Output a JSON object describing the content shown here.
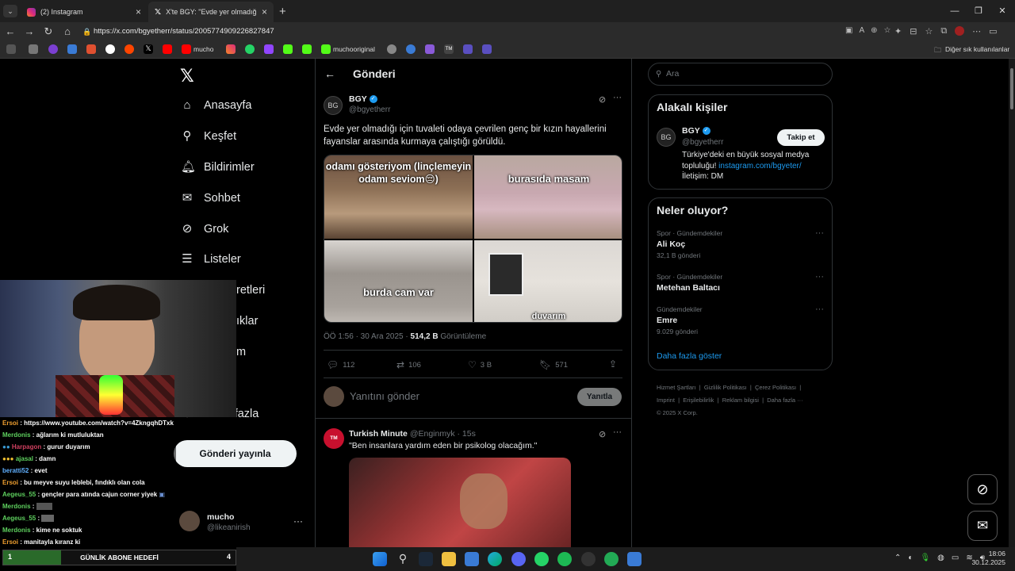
{
  "browser": {
    "tabs": [
      {
        "label": "(2) Instagram",
        "active": false
      },
      {
        "label": "X'te BGY: \"Evde yer olmadığı için tuvaleti odaya çevrilen",
        "active": true
      }
    ],
    "url": "https://x.com/bgyetherr/status/2005774909226827847",
    "bookmarks": [
      "mucho",
      "muchooriginal",
      "Diğer sık kullanılanlar"
    ]
  },
  "x_nav": {
    "items": [
      "Anasayfa",
      "Keşfet",
      "Bildirimler",
      "Sohbet",
      "Grok",
      "Listeler",
      "retleri",
      "ıklar",
      "m",
      "Daha fazla"
    ],
    "post_button": "Gönderi yayınla",
    "account": {
      "name": "mucho",
      "handle": "@likeanirish"
    }
  },
  "post_view": {
    "header": "Gönderi",
    "author": {
      "name": "BGY",
      "handle": "@bgyetherr"
    },
    "text": "Evde yer olmadığı için tuvaleti odaya çevrilen genç bir kızın hayallerini fayanslar arasında kurmaya çalıştığı görüldü.",
    "image_captions": [
      "odamı gösteriyom (linçlemeyin odamı seviom😔)",
      "burasıda masam",
      "burda cam var",
      "duvarım"
    ],
    "meta_time": "ÖÖ 1:56 · 30 Ara 2025 ·",
    "views": "514,2 B",
    "views_label": "Görüntüleme",
    "stats": {
      "replies": "112",
      "reposts": "106",
      "likes": "3 B",
      "bookmarks": "571"
    },
    "reply_placeholder": "Yanıtını gönder",
    "reply_button": "Yanıtla"
  },
  "reply_post": {
    "author": "Turkish Minute",
    "handle_time": "@Enginmyk · 15s",
    "text": "\"Ben insanlara yardım eden bir psikolog olacağım.\""
  },
  "sidebar_right": {
    "search_placeholder": "Ara",
    "relevant_title": "Alakalı kişiler",
    "relevant": {
      "name": "BGY",
      "handle": "@bgyetherr",
      "bio": "Türkiye'deki en büyük sosyal medya topluluğu!",
      "bio_link": "instagram.com/bgyeter/",
      "contact": "İletişim: DM",
      "follow": "Takip et"
    },
    "trends_title": "Neler oluyor?",
    "trends": [
      {
        "category": "Spor · Gündemdekiler",
        "name": "Ali Koç",
        "count": "32,1 B gönderi"
      },
      {
        "category": "Spor · Gündemdekiler",
        "name": "Metehan Baltacı",
        "count": ""
      },
      {
        "category": "Gündemdekiler",
        "name": "Emre",
        "count": "9.029 gönderi"
      }
    ],
    "show_more": "Daha fazla göster",
    "footer": [
      "Hizmet Şartları",
      "Gizlilik Politikası",
      "Çerez Politikası",
      "Imprint",
      "Erişilebilirlik",
      "Reklam bilgisi",
      "Daha fazla ···",
      "© 2025 X Corp."
    ]
  },
  "stream_chat": [
    {
      "user": "Ersoi",
      "color": "#f0a030",
      "msg": "https://www.youtube.com/watch?v=4ZkngqhDTxk"
    },
    {
      "user": "Merdonis",
      "color": "#5ed05e",
      "msg": "ağlarım ki mutluluktan"
    },
    {
      "user": "Harpagon",
      "color": "#d04060",
      "msg": "gurur duyarım"
    },
    {
      "user": "ajasal",
      "color": "#5ed05e",
      "msg": "damn"
    },
    {
      "user": "beratti52",
      "color": "#60b0ff",
      "msg": "evet"
    },
    {
      "user": "Ersoi",
      "color": "#f0a030",
      "msg": "bu meyve suyu leblebi, fındıklı olan cola"
    },
    {
      "user": "Aegeus_55",
      "color": "#5ed05e",
      "msg": "gençler para atında cajun corner yiyek"
    },
    {
      "user": "Merdonis",
      "color": "#5ed05e",
      "msg": ""
    },
    {
      "user": "Aegeus_55",
      "color": "#5ed05e",
      "msg": ""
    },
    {
      "user": "Merdonis",
      "color": "#5ed05e",
      "msg": "kime ne soktuk"
    },
    {
      "user": "Ersoi",
      "color": "#f0a030",
      "msg": "manitayla kıranz ki"
    }
  ],
  "goal_bar": {
    "left": "1",
    "label": "GÜNLİK ABONE HEDEFİ",
    "right": "4",
    "progress": 0.25
  },
  "taskbar": {
    "time": "18:06",
    "date": "30.12.2025"
  }
}
